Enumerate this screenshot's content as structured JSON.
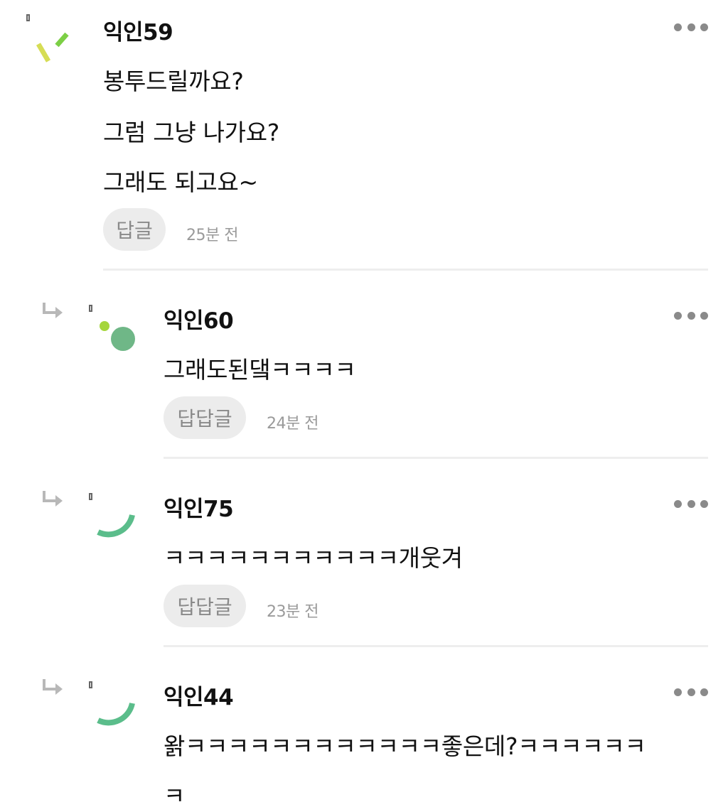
{
  "comments": [
    {
      "nickname": "익인59",
      "lines": [
        "봉투드릴까요?",
        "그럼 그냥 나가요?",
        "그래도 되고요~"
      ],
      "reply_label": "답글",
      "time": "25분 전",
      "avatar_icon": "confetti-avatar-icon"
    },
    {
      "nickname": "익인60",
      "lines": [
        "그래도된댘ㅋㅋㅋㅋ"
      ],
      "reply_label": "답답글",
      "time": "24분 전",
      "avatar_icon": "dots-avatar-icon"
    },
    {
      "nickname": "익인75",
      "lines": [
        "ㅋㅋㅋㅋㅋㅋㅋㅋㅋㅋㅋ개웃겨"
      ],
      "reply_label": "답답글",
      "time": "23분 전",
      "avatar_icon": "arc-avatar-icon"
    },
    {
      "nickname": "익인44",
      "lines": [
        "왉ㅋㅋㅋㅋㅋㅋㅋㅋㅋㅋㅋㅋ좋은데?ㅋㅋㅋㅋㅋㅋ",
        "ㅋ"
      ],
      "avatar_icon": "arc-avatar-icon"
    }
  ],
  "colors": {
    "avatar_green": "#5bbd8b",
    "avatar_lime": "#a5d63c",
    "avatar_yellow": "#d6dd55",
    "reply_bg": "#ececec",
    "muted_text": "#9a9a9a"
  }
}
